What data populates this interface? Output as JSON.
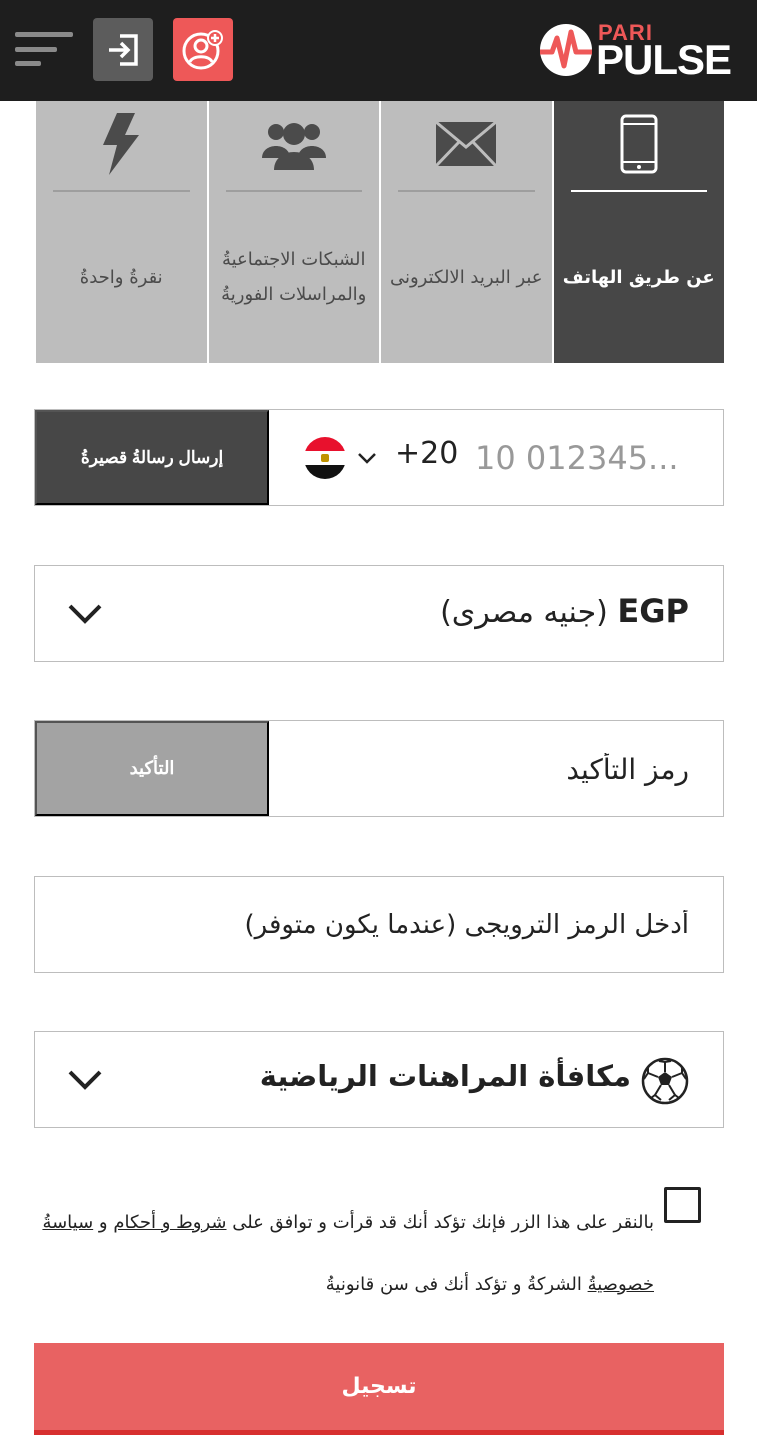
{
  "header": {
    "logo_top": "PARI",
    "logo_bottom": "PULSE",
    "menu_icon": "hamburger-menu-icon",
    "login_icon": "sign-in-icon",
    "register_icon": "add-user-icon"
  },
  "tabs": [
    {
      "label": "عن طريق الهاتف",
      "icon": "phone-icon",
      "active": true
    },
    {
      "label": "عبر البريد الالكترونى",
      "icon": "envelope-icon",
      "active": false
    },
    {
      "label": "الشبكات الاجتماعيةُ والمراسلات الفوريةُ",
      "icon": "users-icon",
      "active": false
    },
    {
      "label": "نقرةُ واحدةُ",
      "icon": "lightning-icon",
      "active": false
    }
  ],
  "phone": {
    "sms_button": "إرسال رسالةُ قصيرةُ",
    "country_code": "+20",
    "placeholder": "10 012345..."
  },
  "currency": {
    "code": "EGP",
    "name": "(جنيه مصرى)"
  },
  "confirmation": {
    "placeholder": "رمز التأكيد",
    "button": "التأكيد"
  },
  "promo": {
    "placeholder": "أدخل الرمز الترويجى (عندما يكون متوفر)"
  },
  "bonus": {
    "label": "مكافأة المراهنات الرياضية",
    "icon": "soccer-ball-icon"
  },
  "terms": {
    "part1": "بالنقر على هذا الزر فإنك تؤكد أنك قد قرأت و توافق على ",
    "link1": "شروط و أحكام",
    "part2": " و ",
    "link2": "سياسةُ خصوصيةُ",
    "part3": " الشركةُ و تؤكد أنك فى سن قانونيةُ"
  },
  "submit_label": "تسجيل",
  "colors": {
    "header_bg": "#1e1e1e",
    "accent_red": "#ee5858",
    "tab_active": "#474747",
    "tab_inactive": "#bdbdbd"
  }
}
